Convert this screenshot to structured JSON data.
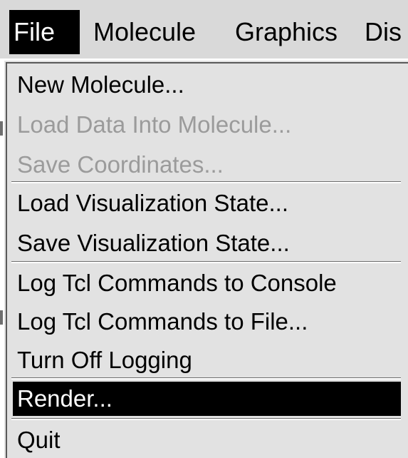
{
  "menubar": {
    "items": [
      {
        "label": "File",
        "active": true
      },
      {
        "label": "Molecule",
        "active": false
      },
      {
        "label": "Graphics",
        "active": false
      },
      {
        "label": "Dis",
        "active": false
      }
    ]
  },
  "file_menu": {
    "groups": [
      [
        {
          "label": "New Molecule...",
          "enabled": true
        },
        {
          "label": "Load Data Into Molecule...",
          "enabled": false
        },
        {
          "label": "Save Coordinates...",
          "enabled": false
        }
      ],
      [
        {
          "label": "Load Visualization State...",
          "enabled": true
        },
        {
          "label": "Save Visualization State...",
          "enabled": true
        }
      ],
      [
        {
          "label": "Log Tcl Commands to Console",
          "enabled": true
        },
        {
          "label": "Log Tcl Commands to File...",
          "enabled": true
        },
        {
          "label": "Turn Off Logging",
          "enabled": true
        }
      ],
      [
        {
          "label": "Render...",
          "enabled": true,
          "highlighted": true
        }
      ],
      [
        {
          "label": "Quit",
          "enabled": true
        }
      ]
    ]
  }
}
